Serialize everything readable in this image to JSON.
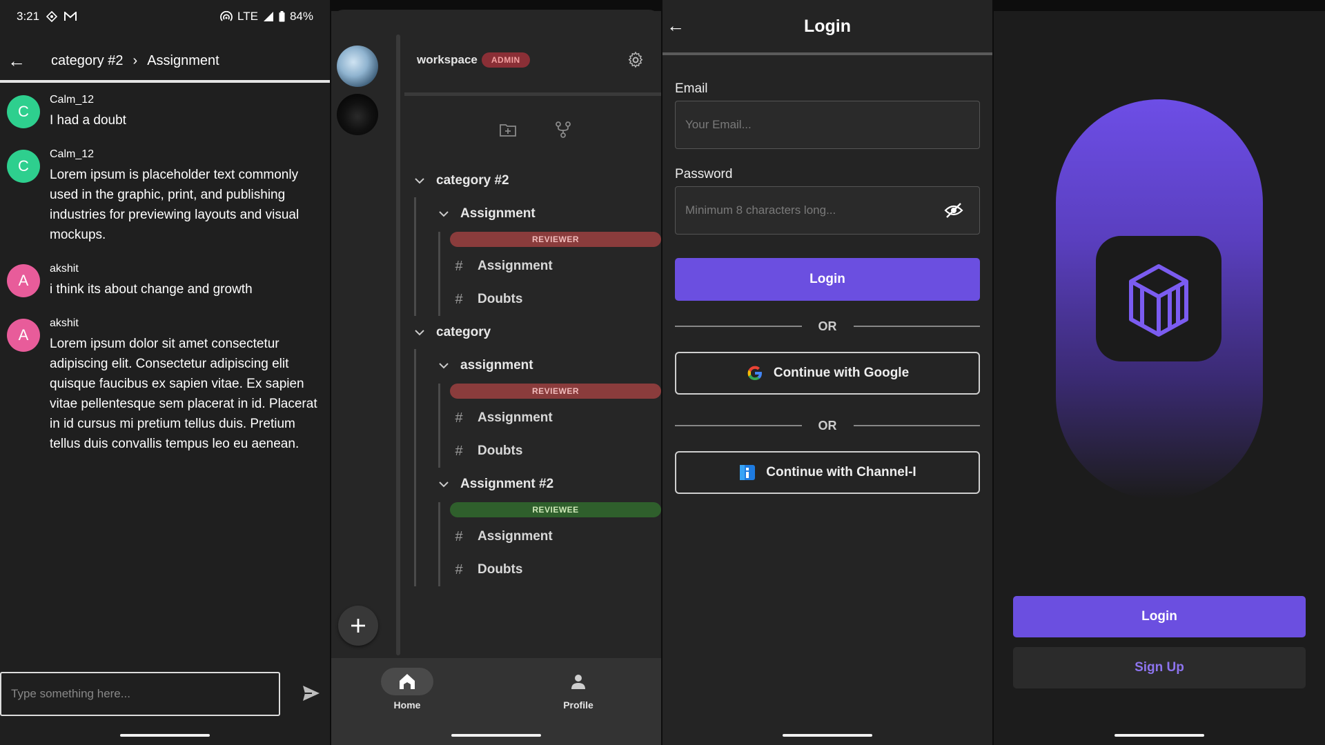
{
  "colors": {
    "accent": "#6b4fe0",
    "admin_badge": "#8a2f36",
    "reviewer_badge": "#8a3c3c",
    "reviewee_badge": "#2f5f2c",
    "avatar_c": "#2ecf8e",
    "avatar_a": "#e85c9a"
  },
  "statusbar": {
    "time": "3:21",
    "network": "LTE",
    "battery": "84%"
  },
  "chat": {
    "breadcrumb": {
      "category": "category #2",
      "channel": "Assignment"
    },
    "messages": [
      {
        "initial": "C",
        "user": "Calm_12",
        "text": "I had a doubt"
      },
      {
        "initial": "C",
        "user": "Calm_12",
        "text": "Lorem ipsum is placeholder text commonly used in the graphic, print, and publishing industries for previewing layouts and visual mockups."
      },
      {
        "initial": "A",
        "user": "akshit",
        "text": "i think its about change and growth"
      },
      {
        "initial": "A",
        "user": "akshit",
        "text": "Lorem ipsum dolor sit amet consectetur adipiscing elit. Consectetur adipiscing elit quisque faucibus ex sapien vitae. Ex sapien vitae pellentesque sem placerat in id. Placerat in id cursus mi pretium tellus duis. Pretium tellus duis convallis tempus leo eu aenean."
      }
    ],
    "input_placeholder": "Type something here..."
  },
  "workspace": {
    "name": "workspace",
    "badge": "ADMIN",
    "categories": [
      {
        "label": "category #2",
        "subs": [
          {
            "label": "Assignment",
            "role": "REVIEWER",
            "channels": [
              "Assignment",
              "Doubts"
            ]
          }
        ]
      },
      {
        "label": "category",
        "subs": [
          {
            "label": "assignment",
            "role": "REVIEWER",
            "channels": [
              "Assignment",
              "Doubts"
            ]
          },
          {
            "label": "Assignment #2",
            "role": "REVIEWEE",
            "channels": [
              "Assignment",
              "Doubts"
            ]
          }
        ]
      }
    ],
    "nav": {
      "home": "Home",
      "profile": "Profile"
    }
  },
  "login": {
    "title": "Login",
    "email_label": "Email",
    "email_placeholder": "Your Email...",
    "password_label": "Password",
    "password_placeholder": "Minimum 8 characters long...",
    "login_button": "Login",
    "or_text": "OR",
    "google_button": "Continue with Google",
    "channel_button": "Continue with Channel-I"
  },
  "welcome": {
    "login_button": "Login",
    "signup_button": "Sign Up"
  }
}
